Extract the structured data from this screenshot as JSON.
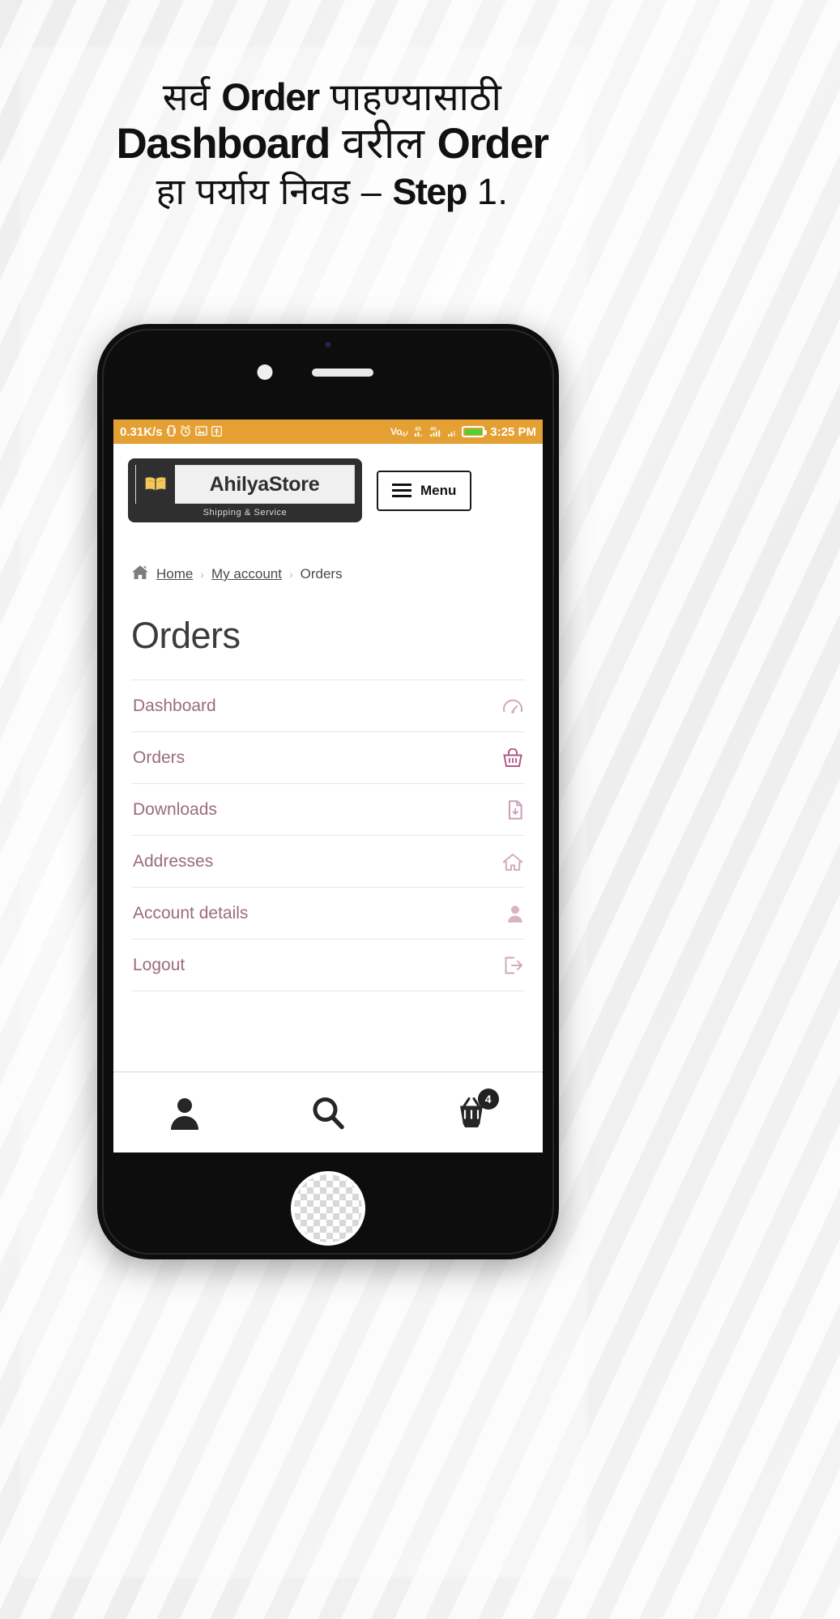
{
  "headline": {
    "line1_pre": "सर्व ",
    "line1_bold": "Order",
    "line1_post": " पाहण्यासाठी",
    "line2_bold": "Dashboard",
    "line2_mid": " वरील ",
    "line2_bold2": "Order",
    "line3_pre": "हा पर्याय निवड – ",
    "line3_bold": "Step",
    "line3_post": " 1."
  },
  "statusbar": {
    "network_speed": "0.31K/s",
    "icons_left": [
      "vibrate-icon",
      "alarm-icon",
      "screenshot-icon",
      "usb-icon"
    ],
    "icons_right": [
      "volte-icon",
      "signal-4g-one-icon",
      "signal-4g-two-icon",
      "wifi-signal-icon"
    ],
    "volte_label": "VoLTE",
    "sim1_label": "4G",
    "sim2_label": "4G",
    "time": "3:25 PM",
    "battery_color": "#4cd137",
    "bar_color": "#e5a033"
  },
  "header": {
    "logo_name": "AhilyaStore",
    "logo_tagline": "Shipping & Service",
    "logo_icon": "open-book-icon",
    "menu_label": "Menu"
  },
  "breadcrumb": {
    "home_icon": "home-icon",
    "items": [
      {
        "label": "Home",
        "link": true
      },
      {
        "label": "My account",
        "link": true
      },
      {
        "label": "Orders",
        "link": false
      }
    ],
    "separator": "›"
  },
  "main": {
    "title": "Orders"
  },
  "account_nav": {
    "items": [
      {
        "label": "Dashboard",
        "icon": "speedometer-icon"
      },
      {
        "label": "Orders",
        "icon": "basket-icon"
      },
      {
        "label": "Downloads",
        "icon": "download-file-icon"
      },
      {
        "label": "Addresses",
        "icon": "house-icon"
      },
      {
        "label": "Account details",
        "icon": "person-icon"
      },
      {
        "label": "Logout",
        "icon": "logout-arrow-icon"
      }
    ],
    "link_color": "#9b6b7e"
  },
  "tabbar": {
    "tabs": [
      {
        "name": "account-tab",
        "icon": "person-icon"
      },
      {
        "name": "search-tab",
        "icon": "search-icon"
      },
      {
        "name": "cart-tab",
        "icon": "cart-icon",
        "badge": "4"
      }
    ]
  }
}
